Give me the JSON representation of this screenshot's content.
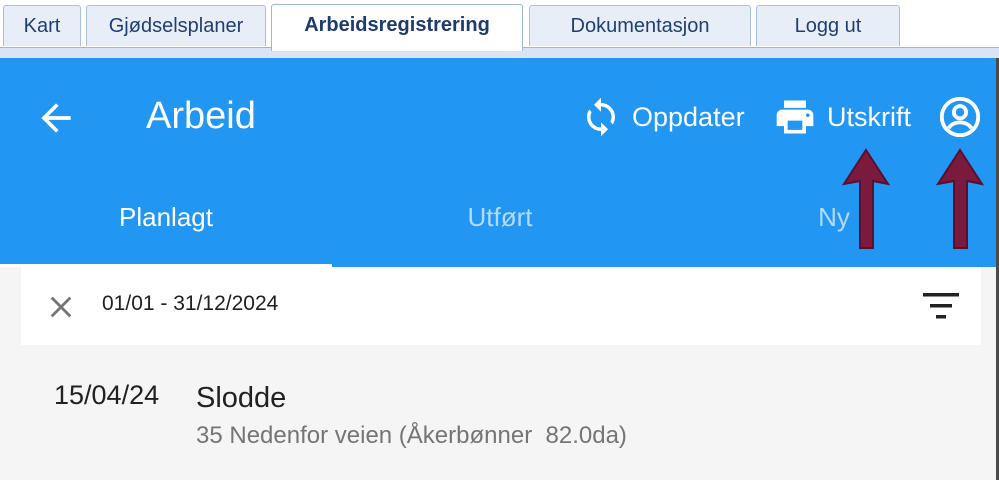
{
  "top_tabs": [
    {
      "label": "Kart"
    },
    {
      "label": "Gjødselsplaner"
    },
    {
      "label": "Arbeidsregistrering",
      "active": true
    },
    {
      "label": "Dokumentasjon"
    },
    {
      "label": "Logg ut"
    }
  ],
  "appbar": {
    "title": "Arbeid",
    "refresh_label": "Oppdater",
    "print_label": "Utskrift",
    "icons": {
      "back": "arrow-back-icon",
      "refresh": "refresh-icon",
      "print": "printer-icon",
      "account": "account-circle-icon"
    }
  },
  "tabs": [
    {
      "label": "Planlagt",
      "selected": true
    },
    {
      "label": "Utført"
    },
    {
      "label": "Ny"
    }
  ],
  "filter": {
    "date_range": "01/01 - 31/12/2024"
  },
  "items": [
    {
      "date": "15/04/24",
      "title": "Slodde",
      "subtitle": "35 Nedenfor veien (Åkerbønner  82.0da)"
    }
  ],
  "colors": {
    "primary": "#2196f3",
    "annotation_arrow": "#7a1a3f"
  }
}
